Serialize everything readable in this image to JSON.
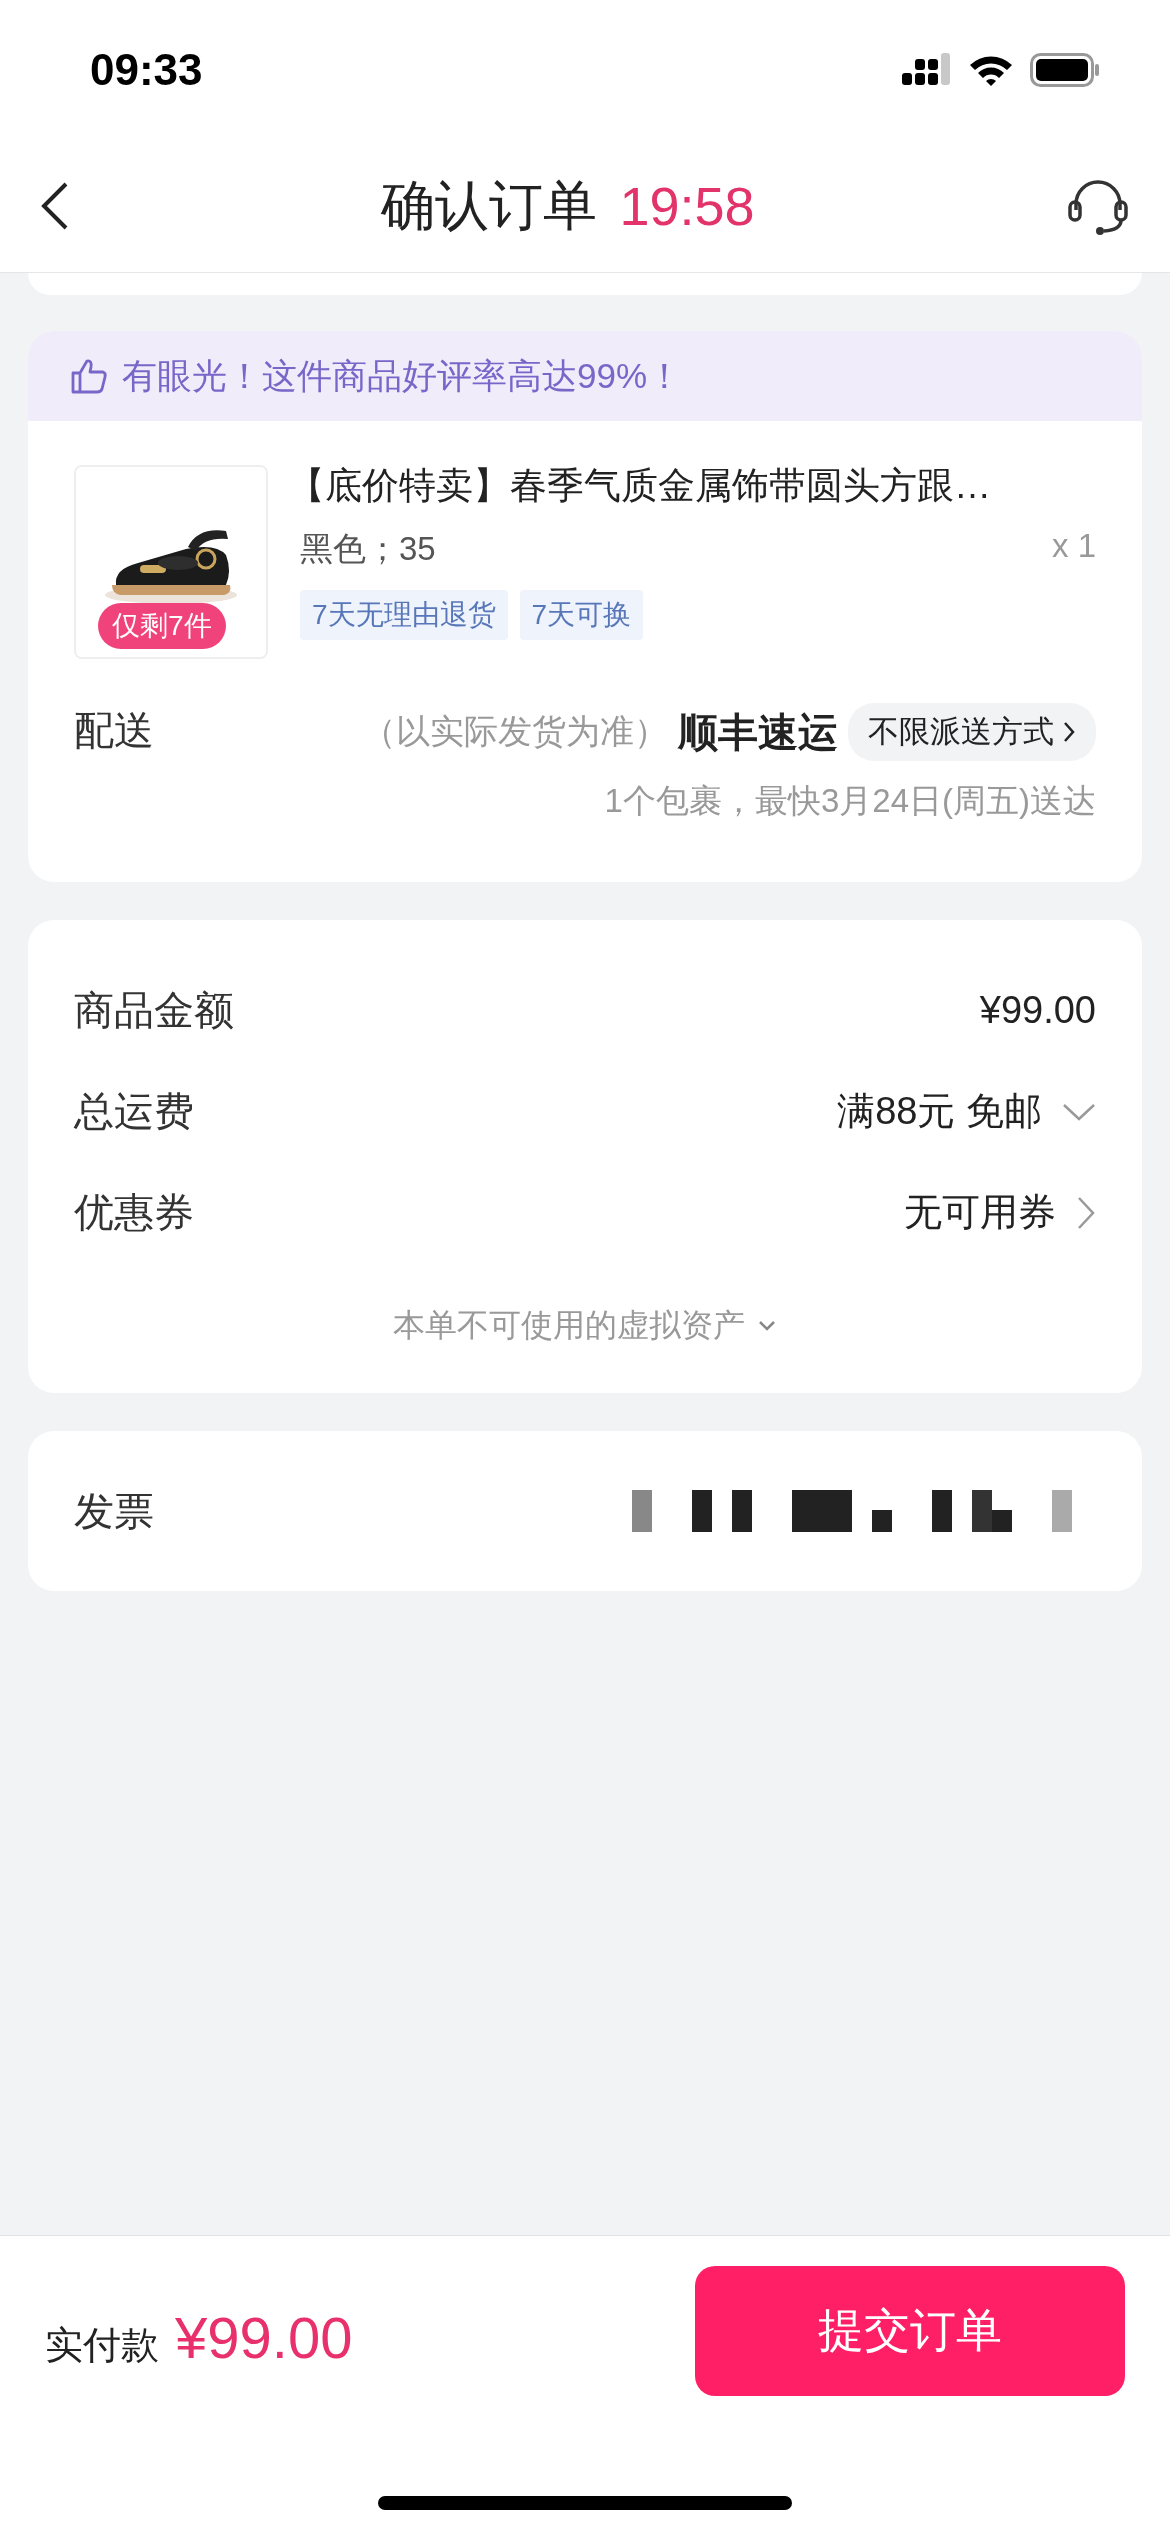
{
  "status_bar": {
    "time": "09:33"
  },
  "nav": {
    "title": "确认订单",
    "countdown": "19:58"
  },
  "product_card": {
    "banner": "有眼光！这件商品好评率高达99%！",
    "product": {
      "image": {
        "kind": "picture"
      },
      "stock_badge": "仅剩7件",
      "title": "【底价特卖】春季气质金属饰带圆头方跟…",
      "variant": "黑色；35",
      "quantity": "x 1",
      "tags": [
        "7天无理由退货",
        "7天可换"
      ]
    },
    "delivery": {
      "label": "配送",
      "note": "（以实际发货为准）",
      "carrier": "顺丰速运",
      "option": "不限派送方式",
      "estimate": "1个包裹，最快3月24日(周五)送达"
    }
  },
  "price_card": {
    "rows": [
      {
        "label": "商品金额",
        "value": "¥99.00",
        "kind": "plain"
      },
      {
        "label": "总运费",
        "value": "满88元 免邮",
        "kind": "dropdown"
      },
      {
        "label": "优惠券",
        "value": "无可用券",
        "kind": "link"
      }
    ],
    "assets_note": "本单不可使用的虚拟资产"
  },
  "invoice": {
    "label": "发票"
  },
  "footer": {
    "total_label": "实付款",
    "total": "¥99.00",
    "submit": "提交订单"
  }
}
